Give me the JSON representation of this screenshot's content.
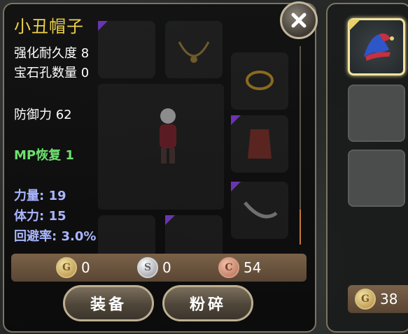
{
  "item": {
    "name": "小丑帽子",
    "enhance_durability": "强化耐久度 8",
    "gem_slots": "宝石孔数量 0",
    "defense": "防御力 62",
    "mp_recovery": "MP恢复 1",
    "strength": "力量: 19",
    "stamina": "体力: 15",
    "evasion": "回避率: 3.0%"
  },
  "currency": {
    "gold": "0",
    "silver": "0",
    "copper": "54",
    "gold_symbol": "G",
    "silver_symbol": "S",
    "copper_symbol": "C"
  },
  "buttons": {
    "equip": "装备",
    "smash": "粉碎"
  },
  "sidebar": {
    "gold": "38",
    "gold_symbol": "G"
  },
  "colors": {
    "title": "#f0d24a",
    "mp_stat": "#6fe06f",
    "attribute_stat": "#a9b6ff",
    "rarity_tag": "#6b34b0"
  }
}
